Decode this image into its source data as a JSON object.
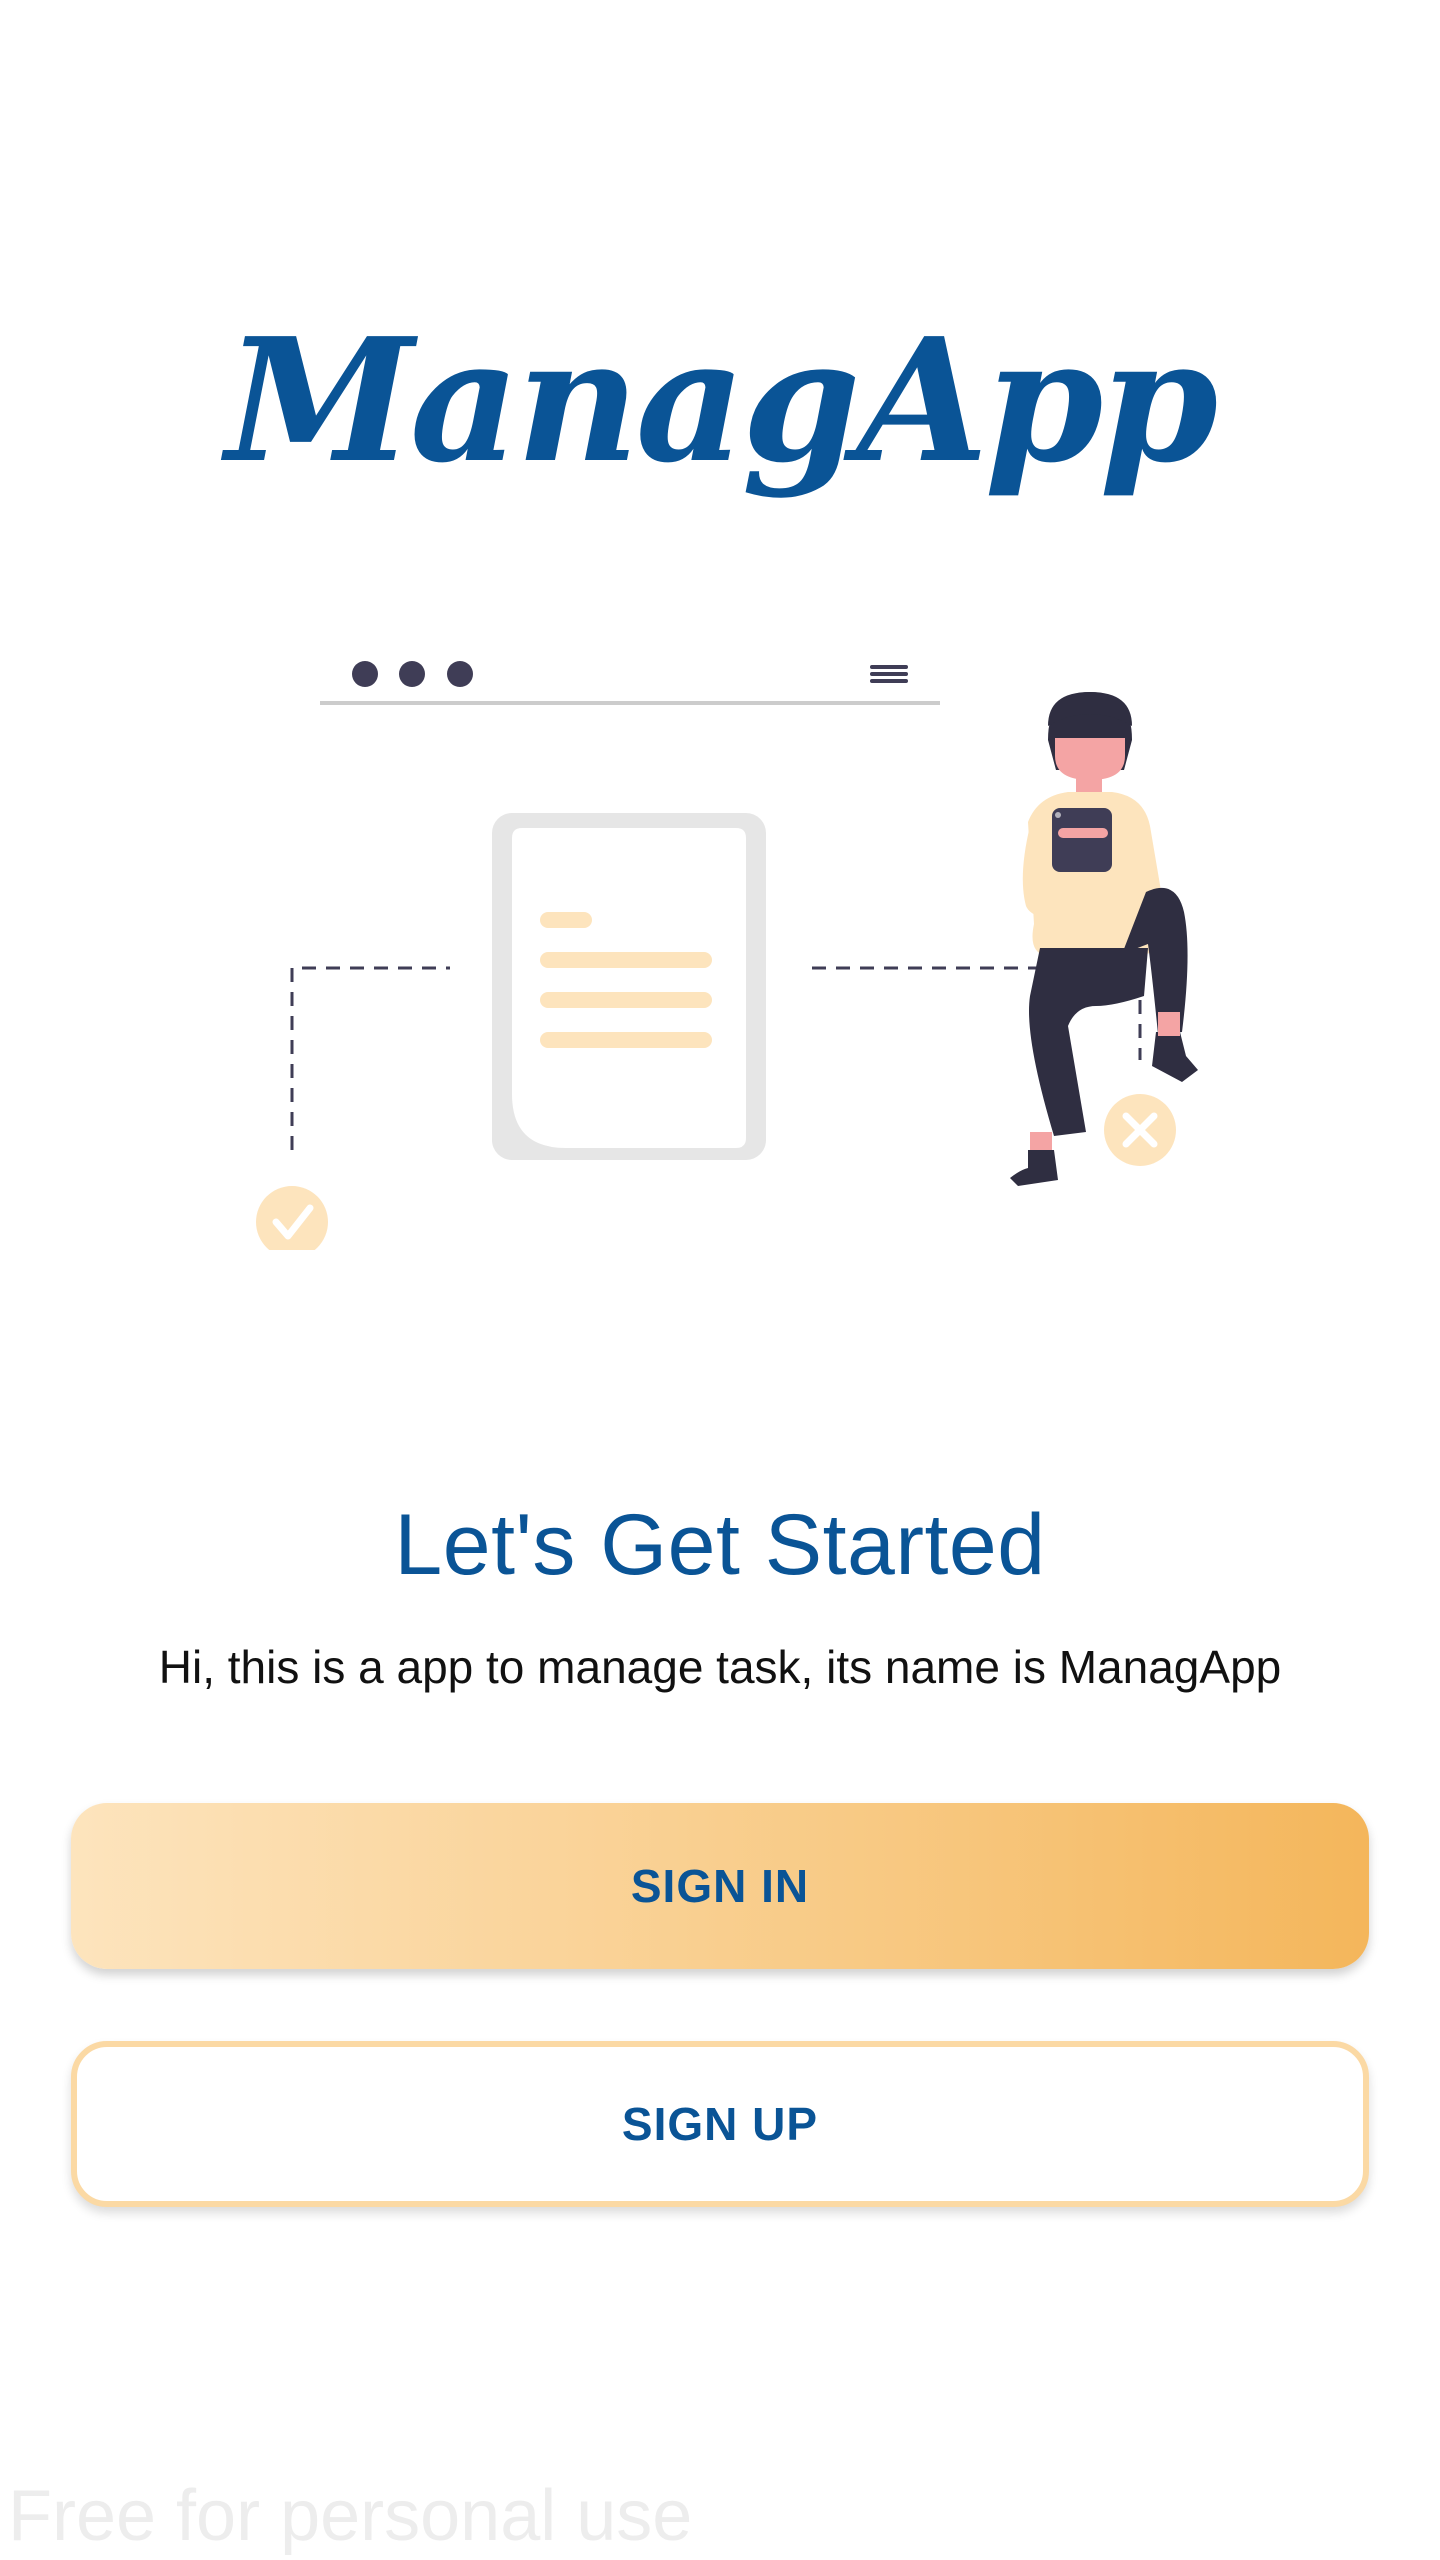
{
  "app": {
    "logo_text": "ManagApp",
    "brand_color": "#0a5496"
  },
  "welcome": {
    "title": "Let's Get Started",
    "subtitle": "Hi, this is a app to manage task, its name is ManagApp"
  },
  "actions": {
    "sign_in_label": "SIGN IN",
    "sign_up_label": "SIGN UP"
  },
  "watermark": {
    "text": "Free for personal use"
  },
  "colors": {
    "accent_light": "#fde4bd",
    "accent_dark": "#f4b65b",
    "signup_border": "#fbd9a4",
    "subtitle_text": "#111111"
  },
  "illustration": {
    "icons": [
      "browser-dots-icon",
      "hamburger-menu-icon",
      "document-icon",
      "check-circle-icon",
      "close-circle-icon",
      "woman-figure"
    ]
  }
}
